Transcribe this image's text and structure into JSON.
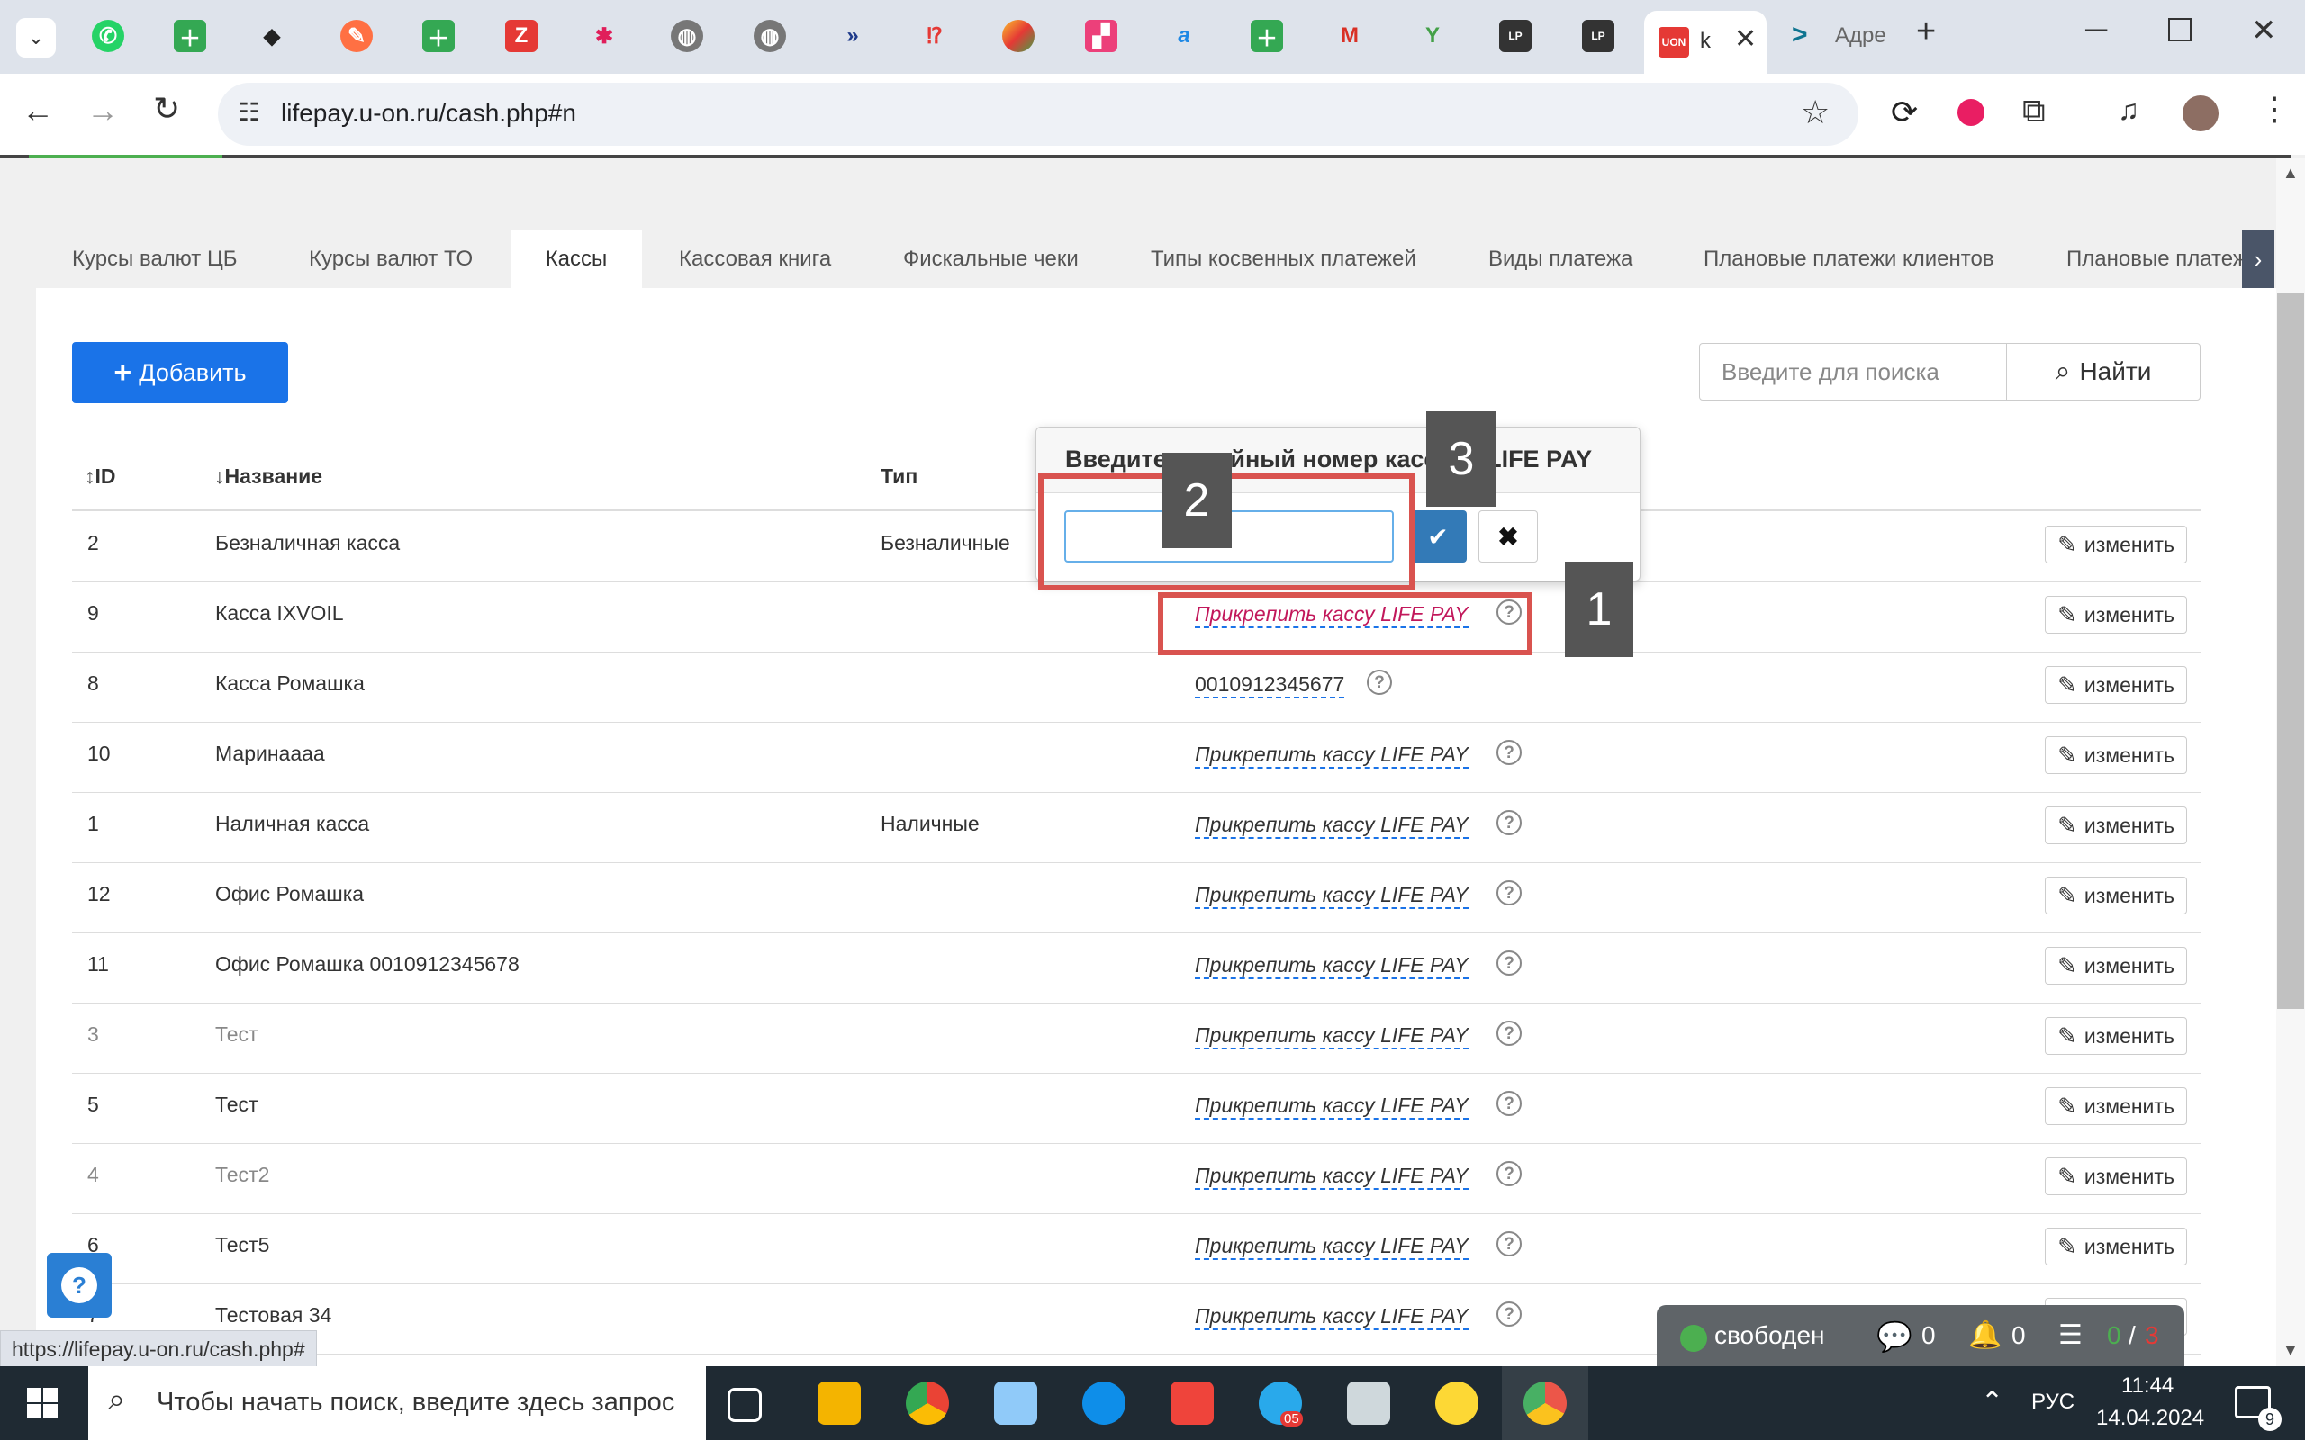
{
  "browser": {
    "url": "lifepay.u-on.ru/cash.php#n",
    "active_tab_label": "k",
    "next_tab_label": "Адре",
    "status_url": "https://lifepay.u-on.ru/cash.php#"
  },
  "nav_tabs": [
    {
      "label": "Курсы валют ЦБ"
    },
    {
      "label": "Курсы валют ТО"
    },
    {
      "label": "Кассы"
    },
    {
      "label": "Кассовая книга"
    },
    {
      "label": "Фискальные чеки"
    },
    {
      "label": "Типы косвенных платежей"
    },
    {
      "label": "Виды платежа"
    },
    {
      "label": "Плановые платежи клиентов"
    },
    {
      "label": "Плановые платеж"
    }
  ],
  "toolbar": {
    "add_label": "Добавить",
    "search_placeholder": "Введите для поиска",
    "find_label": "Найти"
  },
  "table": {
    "headers": {
      "id": "ID",
      "name": "Название",
      "type": "Тип"
    },
    "attach_label": "Прикрепить кассу LIFE PAY",
    "edit_label": "изменить",
    "rows": [
      {
        "id": "2",
        "name": "Безналичная касса",
        "type": "Безналичные",
        "lifepay": "",
        "muted": false
      },
      {
        "id": "9",
        "name": "Касса IXVOIL",
        "type": "",
        "lifepay": "attach",
        "muted": false
      },
      {
        "id": "8",
        "name": "Касса Ромашка",
        "type": "",
        "lifepay": "0010912345677",
        "muted": false
      },
      {
        "id": "10",
        "name": "Маринаааа",
        "type": "",
        "lifepay": "attach",
        "muted": false
      },
      {
        "id": "1",
        "name": "Наличная касса",
        "type": "Наличные",
        "lifepay": "attach",
        "muted": false
      },
      {
        "id": "12",
        "name": "Офис Ромашка",
        "type": "",
        "lifepay": "attach",
        "muted": false
      },
      {
        "id": "11",
        "name": "Офис Ромашка 0010912345678",
        "type": "",
        "lifepay": "attach",
        "muted": false
      },
      {
        "id": "3",
        "name": "Тест",
        "type": "",
        "lifepay": "attach",
        "muted": true
      },
      {
        "id": "5",
        "name": "Тест",
        "type": "",
        "lifepay": "attach",
        "muted": false
      },
      {
        "id": "4",
        "name": "Тест2",
        "type": "",
        "lifepay": "attach",
        "muted": true
      },
      {
        "id": "6",
        "name": "Тест5",
        "type": "",
        "lifepay": "attach",
        "muted": false
      },
      {
        "id": "7",
        "name": "Тестовая 34",
        "type": "",
        "lifepay": "attach",
        "muted": false
      }
    ]
  },
  "popover": {
    "title": "Введите серийный номер кассы в LIFE PAY",
    "input_value": ""
  },
  "markers": [
    "1",
    "2",
    "3"
  ],
  "status_widget": {
    "state": "свободен",
    "messages": "0",
    "notifications": "0",
    "tasks_done": "0",
    "tasks_sep": "/",
    "tasks_total": "3"
  },
  "taskbar": {
    "search_placeholder": "Чтобы начать поиск, введите здесь запрос",
    "lang": "РУС",
    "time": "11:44",
    "date": "14.04.2024",
    "notif_count": "9",
    "telegram_badge": "05"
  },
  "colors": {
    "primary": "#1a73e8",
    "annotation_red": "#d9534f",
    "marker_bg": "#555555",
    "ok_button": "#337ab7",
    "status_free": "#4caf50",
    "tasks_total": "#e53935"
  }
}
